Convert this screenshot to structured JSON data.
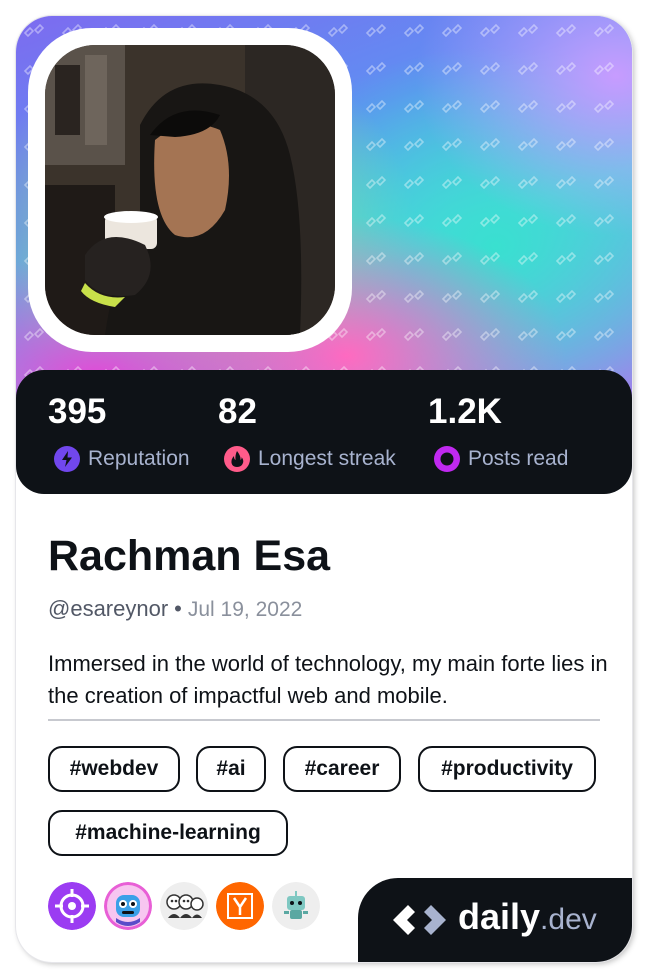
{
  "profile": {
    "name": "Rachman Esa",
    "handle": "@esareynor",
    "separator": "•",
    "joined": "Jul 19, 2022",
    "bio": "Immersed in the world of technology, my main forte lies in the creation of impactful web and mobile."
  },
  "stats": [
    {
      "value": "395",
      "label": "Reputation",
      "icon": "lightning-icon",
      "color": "#7147ed"
    },
    {
      "value": "82",
      "label": "Longest streak",
      "icon": "flame-icon",
      "color": "#ff5b8a"
    },
    {
      "value": "1.2K",
      "label": "Posts read",
      "icon": "eye-icon",
      "color": "#c029f0"
    }
  ],
  "tags": [
    "#webdev",
    "#ai",
    "#career",
    "#productivity",
    "#machine-learning"
  ],
  "badges": [
    "crosshair-badge",
    "robot-badge",
    "team-badge",
    "y-badge",
    "bot-badge"
  ],
  "brand": {
    "main": "daily",
    "suffix": ".dev"
  },
  "colors": {
    "card_dark": "#0e1217",
    "muted": "#a8b3cf"
  }
}
